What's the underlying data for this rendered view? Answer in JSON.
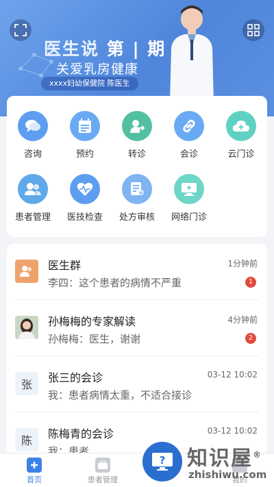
{
  "banner": {
    "title_main": "医生说",
    "title_issue": "第 | 期",
    "subtitle": "关爱乳房健康",
    "tag": "xxxx妇幼保健院   陈医生"
  },
  "functions": [
    {
      "label": "咨询",
      "icon": "chat-icon",
      "color": "#5d9ef0"
    },
    {
      "label": "预约",
      "icon": "calendar-icon",
      "color": "#6aaaf4"
    },
    {
      "label": "转诊",
      "icon": "transfer-icon",
      "color": "#52c0a0"
    },
    {
      "label": "会诊",
      "icon": "link-icon",
      "color": "#6aaaf4"
    },
    {
      "label": "云门诊",
      "icon": "cloud-icon",
      "color": "#5fd1c3"
    },
    {
      "label": "患者管理",
      "icon": "patients-icon",
      "color": "#5fa8ea"
    },
    {
      "label": "医技检查",
      "icon": "heart-pulse-icon",
      "color": "#5d9ef0"
    },
    {
      "label": "处方审核",
      "icon": "prescription-icon",
      "color": "#7eb4f0"
    },
    {
      "label": "网络门诊",
      "icon": "monitor-icon",
      "color": "#6ed6c6"
    }
  ],
  "messages": [
    {
      "title": "医生群",
      "preview": "李四：这个患者的病情不严重",
      "time": "1分钟前",
      "badge": "1",
      "avatar": "group-icon"
    },
    {
      "title": "孙梅梅的专家解读",
      "preview": "孙梅梅：医生，谢谢",
      "time": "4分钟前",
      "badge": "2",
      "avatar": "photo"
    },
    {
      "title": "张三的会诊",
      "preview": "我：患者病情太重，不适合接诊",
      "time": "03-12 10:02",
      "avatar_text": "张"
    },
    {
      "title": "陈梅青的会诊",
      "preview": "我：患者",
      "time": "03-12 10:02",
      "avatar_text": "陈"
    }
  ],
  "tabs": [
    {
      "label": "首页",
      "icon": "home-icon"
    },
    {
      "label": "患者管理",
      "icon": "briefcase-icon"
    },
    {
      "label": "",
      "icon": "phone-icon"
    },
    {
      "label": "我的",
      "icon": "user-icon"
    }
  ],
  "watermark": {
    "title": "知识屋",
    "url": "zhishiwu.com",
    "reg": "®"
  }
}
